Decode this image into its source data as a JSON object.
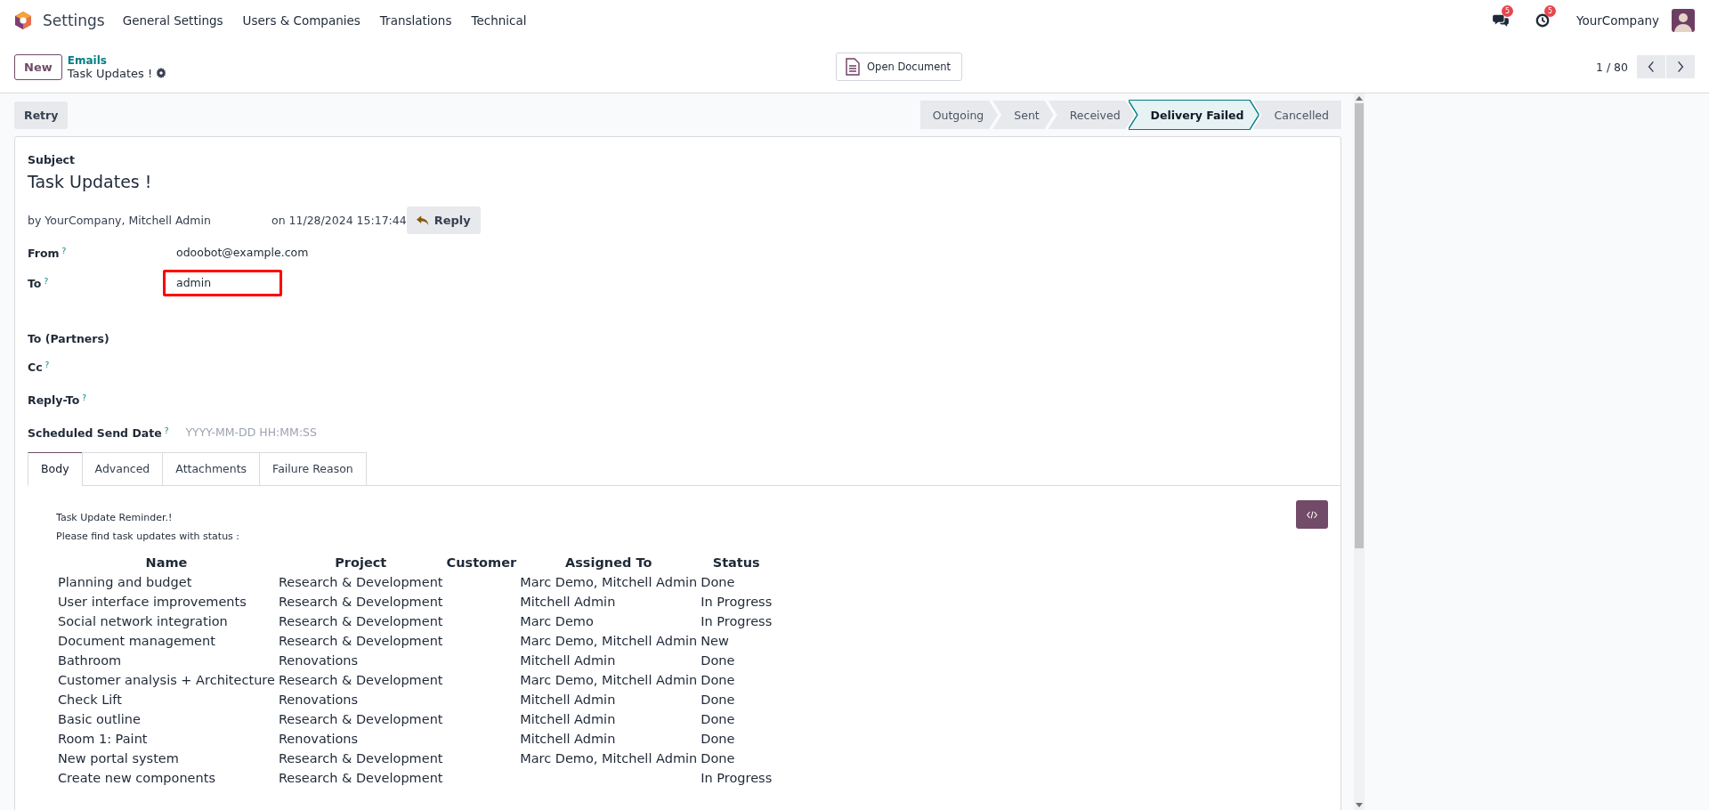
{
  "navbar": {
    "app_name": "Settings",
    "menu": [
      "General Settings",
      "Users & Companies",
      "Translations",
      "Technical"
    ],
    "messages_badge": "5",
    "activities_badge": "5",
    "company": "YourCompany"
  },
  "control_panel": {
    "new_button": "New",
    "breadcrumb": "Emails",
    "record_title": "Task Updates !",
    "open_document": "Open Document",
    "pager": "1 / 80"
  },
  "action_button": "Retry",
  "status_steps": [
    {
      "label": "Outgoing",
      "selected": false
    },
    {
      "label": "Sent",
      "selected": false
    },
    {
      "label": "Received",
      "selected": false
    },
    {
      "label": "Delivery Failed",
      "selected": true
    },
    {
      "label": "Cancelled",
      "selected": false
    }
  ],
  "form": {
    "subject_label": "Subject",
    "subject": "Task Updates !",
    "author": "by YourCompany, Mitchell Admin",
    "date": "on 11/28/2024 15:17:44",
    "reply_button": "Reply",
    "fields": [
      {
        "label": "From",
        "help": "?",
        "value": "odoobot@example.com",
        "highlighted": false
      },
      {
        "label": "To",
        "help": "?",
        "value": "admin",
        "highlighted": true
      },
      {
        "label": "To (Partners)",
        "highlighted": false
      },
      {
        "label": "Cc",
        "help": "?",
        "highlighted": false
      },
      {
        "label": "Reply-To",
        "help": "?",
        "highlighted": false
      },
      {
        "label": "Scheduled Send Date",
        "help": "?",
        "placeholder": "YYYY-MM-DD HH:MM:SS",
        "highlighted": false
      }
    ]
  },
  "tabs": [
    {
      "label": "Body",
      "selected": true
    },
    {
      "label": "Advanced",
      "selected": false
    },
    {
      "label": "Attachments",
      "selected": false
    },
    {
      "label": "Failure Reason",
      "selected": false
    }
  ],
  "body": {
    "intro": "Task Update Reminder.!",
    "line": "Please find task updates with status :",
    "table": {
      "columns": [
        "Name",
        "Project",
        "Customer",
        "Assigned To",
        "Status"
      ],
      "rows": [
        {
          "name": "Planning and budget",
          "project": "Research & Development",
          "assigned_to": "Marc Demo, Mitchell Admin",
          "status": "Done"
        },
        {
          "name": "User interface improvements",
          "project": "Research & Development",
          "assigned_to": "Mitchell Admin",
          "status": "In Progress"
        },
        {
          "name": "Social network integration",
          "project": "Research & Development",
          "assigned_to": "Marc Demo",
          "status": "In Progress"
        },
        {
          "name": "Document management",
          "project": "Research & Development",
          "assigned_to": "Marc Demo, Mitchell Admin",
          "status": "New"
        },
        {
          "name": "Bathroom",
          "project": "Renovations",
          "assigned_to": "Mitchell Admin",
          "status": "Done"
        },
        {
          "name": "Customer analysis + Architecture",
          "project": "Research & Development",
          "assigned_to": "Marc Demo, Mitchell Admin",
          "status": "Done"
        },
        {
          "name": "Check Lift",
          "project": "Renovations",
          "assigned_to": "Mitchell Admin",
          "status": "Done"
        },
        {
          "name": "Basic outline",
          "project": "Research & Development",
          "assigned_to": "Mitchell Admin",
          "status": "Done"
        },
        {
          "name": "Room 1: Paint",
          "project": "Renovations",
          "assigned_to": "Mitchell Admin",
          "status": "Done"
        },
        {
          "name": "New portal system",
          "project": "Research & Development",
          "assigned_to": "Marc Demo, Mitchell Admin",
          "status": "Done"
        },
        {
          "name": "Create new components",
          "project": "Research & Development",
          "status": "In Progress"
        }
      ]
    }
  }
}
